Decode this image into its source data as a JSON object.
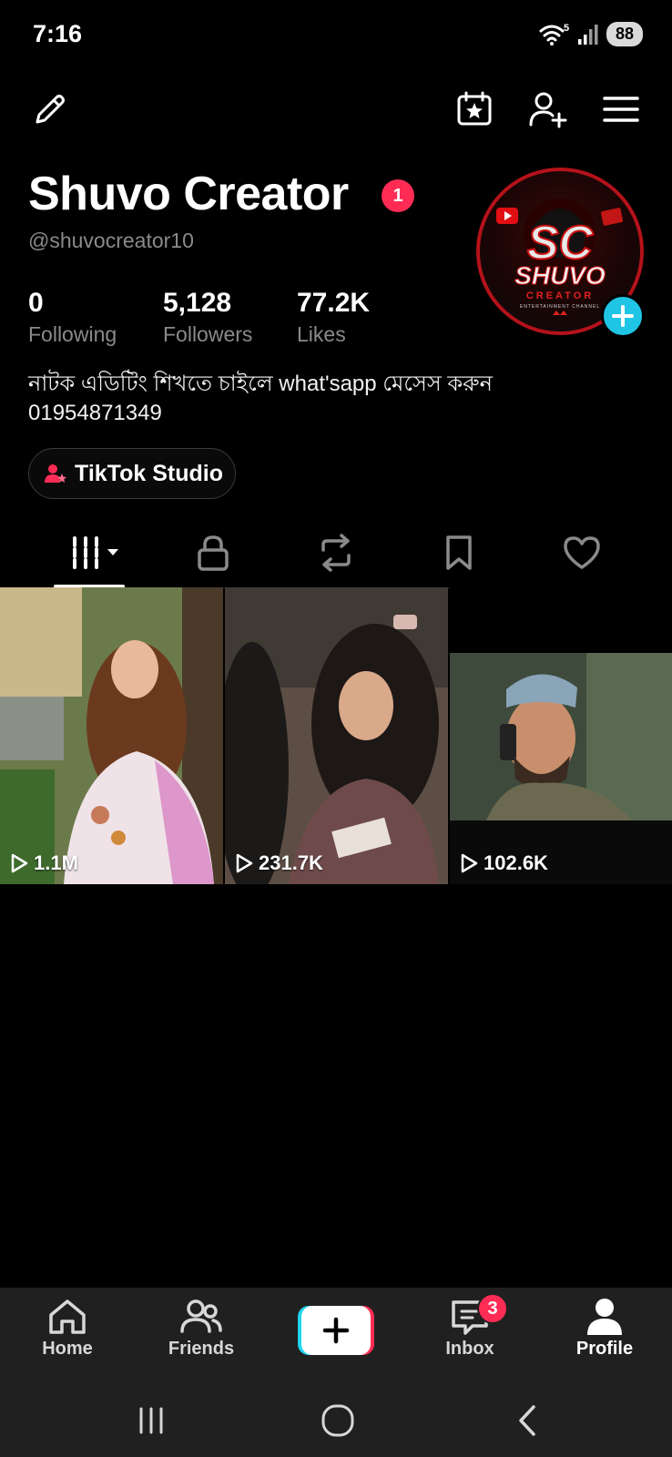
{
  "status_bar": {
    "time": "7:16",
    "wifi_label": "5",
    "battery": "88"
  },
  "profile": {
    "name": "Shuvo Creator",
    "name_badge": "1",
    "username": "@shuvocreator10",
    "bio_line1": "নাটক এডিটিং শিখতে চাইলে  what'sapp মেসেস করুন",
    "bio_line2": "01954871349"
  },
  "stats": [
    {
      "value": "0",
      "label": "Following"
    },
    {
      "value": "5,128",
      "label": "Followers"
    },
    {
      "value": "77.2K",
      "label": "Likes"
    }
  ],
  "studio_button": {
    "label": "TikTok Studio"
  },
  "videos": [
    {
      "views": "1.1M"
    },
    {
      "views": "231.7K"
    },
    {
      "views": "102.6K"
    }
  ],
  "bottom_nav": {
    "home": "Home",
    "friends": "Friends",
    "inbox": "Inbox",
    "inbox_badge": "3",
    "profile": "Profile"
  },
  "avatar_logo": {
    "letters": "SC",
    "line1": "SHUVO",
    "line2": "CREATOR",
    "line3": "ENTERTAINMENT CHANNEL"
  },
  "colors": {
    "accent_red": "#fe2c55",
    "accent_cyan": "#20c5e5",
    "background": "#000000",
    "nav_background": "#202020"
  }
}
